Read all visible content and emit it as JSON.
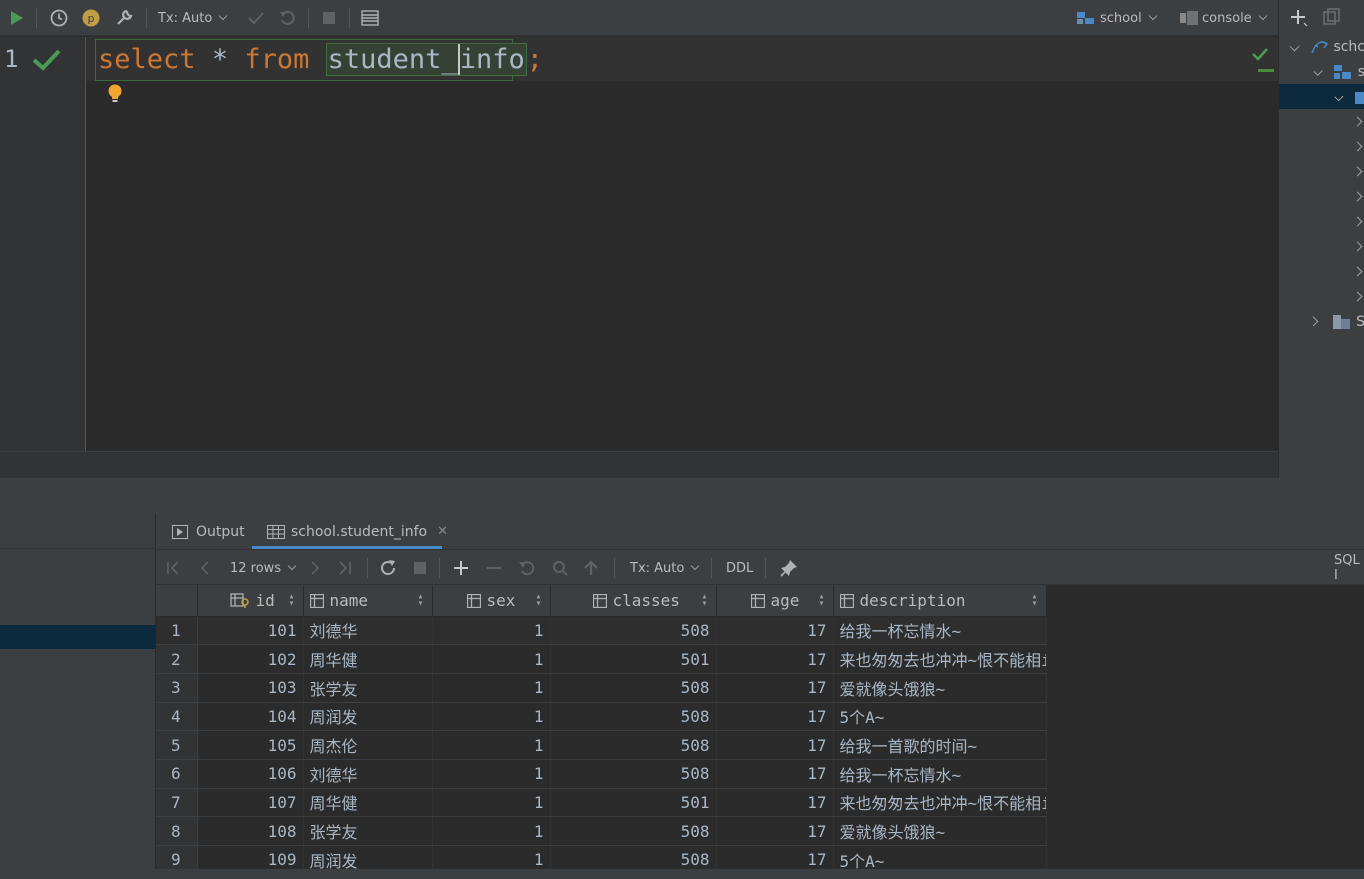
{
  "toolbar": {
    "tx_mode": "Tx: Auto",
    "datasource": "school",
    "session": "console"
  },
  "editor": {
    "line_number": "1",
    "sql_keyword_select": "select",
    "sql_star": "*",
    "sql_keyword_from": "from",
    "sql_table_a": "student_",
    "sql_table_b": "info",
    "sql_semicolon": ";"
  },
  "project_tree": {
    "root": "schc",
    "schema": "s",
    "last": "S"
  },
  "bottom_tabs": {
    "output": "Output",
    "result": "school.student_info"
  },
  "grid_toolbar": {
    "rows": "12 rows",
    "tx_mode": "Tx: Auto",
    "ddl": "DDL",
    "sql_label": "SQL I"
  },
  "columns": [
    "id",
    "name",
    "sex",
    "classes",
    "age",
    "description"
  ],
  "rows": [
    {
      "n": "1",
      "id": "101",
      "name": "刘德华",
      "sex": "1",
      "classes": "508",
      "age": "17",
      "description": "给我一杯忘情水~"
    },
    {
      "n": "2",
      "id": "102",
      "name": "周华健",
      "sex": "1",
      "classes": "501",
      "age": "17",
      "description": "来也匆匆去也冲冲~恨不能相i"
    },
    {
      "n": "3",
      "id": "103",
      "name": "张学友",
      "sex": "1",
      "classes": "508",
      "age": "17",
      "description": "爱就像头饿狼~"
    },
    {
      "n": "4",
      "id": "104",
      "name": "周润发",
      "sex": "1",
      "classes": "508",
      "age": "17",
      "description": "5个A~"
    },
    {
      "n": "5",
      "id": "105",
      "name": "周杰伦",
      "sex": "1",
      "classes": "508",
      "age": "17",
      "description": "给我一首歌的时间~"
    },
    {
      "n": "6",
      "id": "106",
      "name": "刘德华",
      "sex": "1",
      "classes": "508",
      "age": "17",
      "description": "给我一杯忘情水~"
    },
    {
      "n": "7",
      "id": "107",
      "name": "周华健",
      "sex": "1",
      "classes": "501",
      "age": "17",
      "description": "来也匆匆去也冲冲~恨不能相i"
    },
    {
      "n": "8",
      "id": "108",
      "name": "张学友",
      "sex": "1",
      "classes": "508",
      "age": "17",
      "description": "爱就像头饿狼~"
    },
    {
      "n": "9",
      "id": "109",
      "name": "周润发",
      "sex": "1",
      "classes": "508",
      "age": "17",
      "description": "5个A~"
    }
  ],
  "colors": {
    "keyword": "#cc7832",
    "run_green": "#499c54",
    "selection": "#0d293e"
  }
}
